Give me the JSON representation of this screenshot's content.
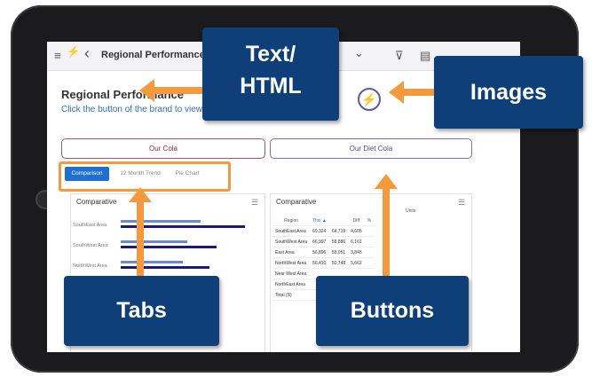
{
  "toolbar": {
    "menu_icon": "≡",
    "back_icon": "‹",
    "title": "Regional Performance",
    "chevron_icon": "⌄",
    "filter_icon": "⊽",
    "message_icon": "▤"
  },
  "header": {
    "title": "Regional Performance",
    "subtitle": "Click the button of the brand to view performance.",
    "logo_icon": "lightning-logo-icon"
  },
  "buttons": [
    {
      "label": "Our Cola"
    },
    {
      "label": "Our Diet Cola"
    }
  ],
  "tabs": [
    {
      "label": "Comparison",
      "active": true
    },
    {
      "label": "12 Month Trend",
      "active": false
    },
    {
      "label": "Pie Chart",
      "active": false
    }
  ],
  "left_panel": {
    "title": "Comparative",
    "bar_labels": [
      "SouthEast Area",
      "SouthWest Area",
      "NorthWest Area"
    ]
  },
  "right_panel": {
    "title": "Comparative",
    "units_label": "Units",
    "columns": [
      "Region",
      "This ▲",
      "",
      "Diff",
      "%"
    ],
    "rows": [
      [
        "SouthEast Area",
        "69,324",
        "64,719",
        "4,605",
        ""
      ],
      [
        "SouthWest Area",
        "66,997",
        "58,886",
        "6,161",
        ""
      ],
      [
        "East Area",
        "56,896",
        "53,051",
        "3,845",
        ""
      ],
      [
        "NorthWest Area",
        "56,410",
        "50,748",
        "5,662",
        ""
      ],
      [
        "Near West Area",
        "",
        "",
        "",
        ""
      ],
      [
        "NorthEast Area",
        "",
        "",
        "",
        ""
      ],
      [
        "Total (S)",
        "",
        "",
        "",
        ""
      ]
    ]
  },
  "callouts": {
    "text_html": "Text/\nHTML",
    "images": "Images",
    "tabs": "Tabs",
    "buttons": "Buttons"
  },
  "colors": {
    "callout_bg": "#0e3f78",
    "arrow": "#f49a3c",
    "active_tab": "#1f6fd0",
    "bar_dark": "#1a1a7a",
    "bar_light": "#6a8ad8"
  }
}
